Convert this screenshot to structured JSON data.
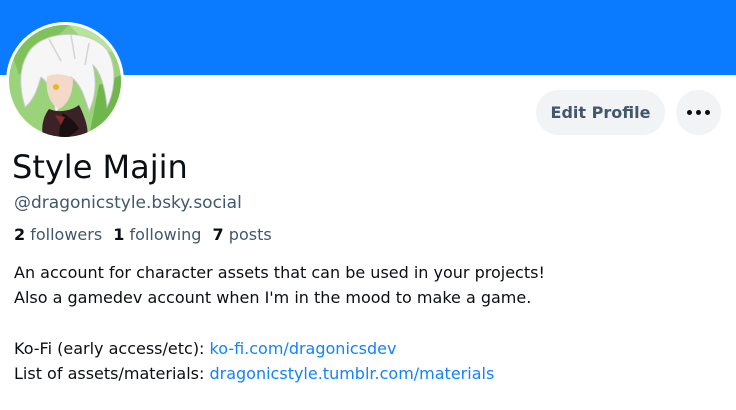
{
  "profile": {
    "display_name": "Style Majin",
    "handle": "@dragonicstyle.bsky.social",
    "stats": {
      "followers_count": "2",
      "followers_label": "followers",
      "following_count": "1",
      "following_label": "following",
      "posts_count": "7",
      "posts_label": "posts"
    },
    "bio": {
      "line1": "An account for character assets that can be used in your projects!",
      "line2": "Also a gamedev account when I'm in the mood to make a game.",
      "kofi_label": "Ko-Fi (early access/etc): ",
      "kofi_link": "ko-fi.com/dragonicsdev",
      "assets_label": "List of assets/materials: ",
      "assets_link": "dragonicstyle.tumblr.com/materials"
    }
  },
  "actions": {
    "edit_profile_label": "Edit Profile",
    "more_icon": "ellipsis-icon"
  },
  "colors": {
    "banner": "#0a7aff",
    "link": "#1083fe",
    "muted_text": "#42576c",
    "button_bg": "#f1f3f5"
  }
}
